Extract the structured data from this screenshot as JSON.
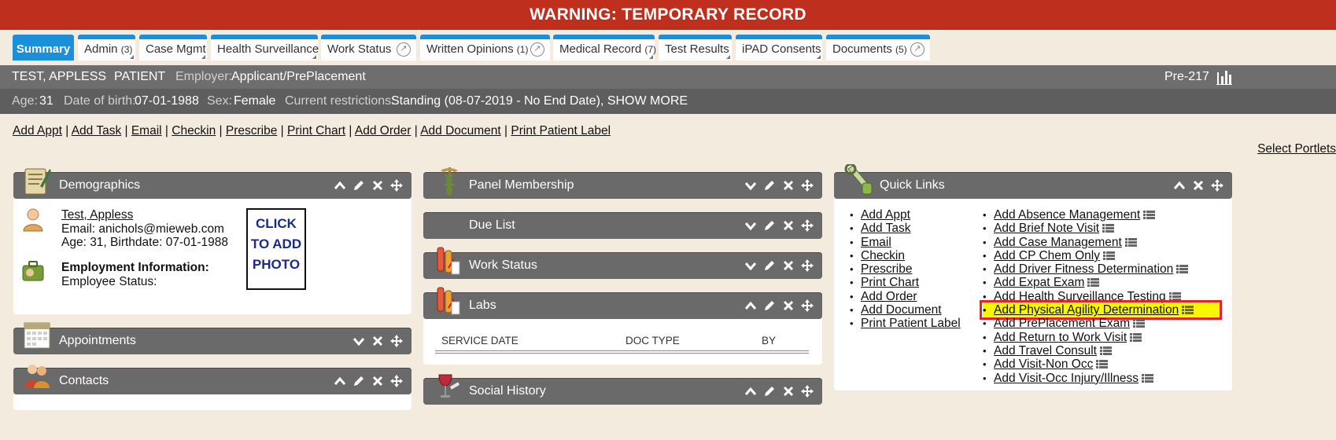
{
  "warning": "WARNING: TEMPORARY RECORD",
  "tabs": [
    {
      "label": "Summary",
      "count": "",
      "active": true
    },
    {
      "label": "Admin",
      "count": "(3)"
    },
    {
      "label": "Case Mgmt",
      "count": ""
    },
    {
      "label": "Health Surveillance",
      "count": ""
    },
    {
      "label": "Work Status",
      "count": ""
    },
    {
      "label": "Written Opinions",
      "count": "(1)"
    },
    {
      "label": "Medical Record",
      "count": "(7)"
    },
    {
      "label": "Test Results",
      "count": ""
    },
    {
      "label": "iPAD Consents",
      "count": ""
    },
    {
      "label": "Documents",
      "count": "(5)"
    }
  ],
  "patient": {
    "name": "TEST, APPLESS",
    "role": "PATIENT",
    "employer_label": "Employer:",
    "employer": "Applicant/PrePlacement",
    "record_id": "Pre-217",
    "age_label": "Age:",
    "age": "31",
    "dob_label": "Date of birth:",
    "dob": "07-01-1988",
    "sex_label": "Sex:",
    "sex": "Female",
    "restrictions_label": "Current restrictions:",
    "restrictions": "Standing (08-07-2019 - No End Date), SHOW MORE"
  },
  "actions": [
    "Add Appt",
    "Add Task",
    "Email",
    "Checkin",
    "Prescribe",
    "Print Chart",
    "Add Order",
    "Add Document",
    "Print Patient Label"
  ],
  "select_portlets": "Select Portlets",
  "demographics": {
    "title": "Demographics",
    "name_link": "Test, Appless",
    "email": "Email: anichols@mieweb.com",
    "age_line": "Age: 31, Birthdate: 07-01-1988",
    "employment_heading": "Employment Information:",
    "employee_status": "Employee Status:",
    "photo_lines": [
      "CLICK",
      "TO ADD",
      "PHOTO"
    ]
  },
  "appointments": {
    "title": "Appointments"
  },
  "contacts": {
    "title": "Contacts"
  },
  "panel_membership": {
    "title": "Panel Membership"
  },
  "due_list": {
    "title": "Due List"
  },
  "work_status": {
    "title": "Work Status"
  },
  "labs": {
    "title": "Labs",
    "columns": [
      "SERVICE DATE",
      "DOC TYPE",
      "BY"
    ]
  },
  "social_history": {
    "title": "Social History"
  },
  "quick_links": {
    "title": "Quick Links",
    "left": [
      "Add Appt",
      "Add Task",
      "Email",
      "Checkin",
      "Prescribe",
      "Print Chart",
      "Add Order",
      "Add Document",
      "Print Patient Label"
    ],
    "right": [
      "Add Absence Management",
      "Add Brief Note Visit",
      "Add Case Management",
      "Add CP Chem Only",
      "Add Driver Fitness Determination",
      "Add Expat Exam",
      "Add Health Surveillance Testing",
      "Add Physical Agility Determination",
      "Add PrePlacement Exam",
      "Add Return to Work Visit",
      "Add Travel Consult",
      "Add Visit-Non Occ",
      "Add Visit-Occ Injury/Illness"
    ],
    "highlighted_index": 7
  },
  "colors": {
    "warning": "#bf2f1e",
    "tab_accent": "#1b8fd9",
    "highlight": "#f7f700",
    "highlight_border": "#e8202a"
  }
}
